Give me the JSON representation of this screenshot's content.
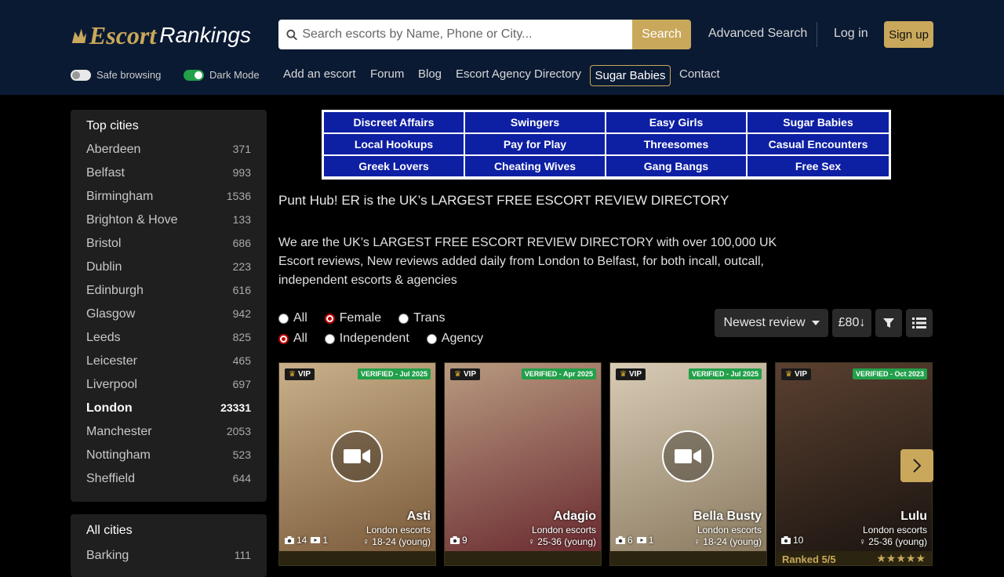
{
  "header": {
    "logo_part1": "Escort",
    "logo_part2": "Rankings",
    "search_placeholder": "Search escorts by Name, Phone or City...",
    "search_button": "Search",
    "advanced_search": "Advanced Search",
    "login": "Log in",
    "signup": "Sign up",
    "toggles": [
      {
        "label": "Safe browsing",
        "on": false
      },
      {
        "label": "Dark Mode",
        "on": true
      }
    ],
    "nav": [
      "Add an escort",
      "Forum",
      "Blog",
      "Escort Agency Directory",
      "Sugar Babies",
      "Contact"
    ]
  },
  "sidebar": {
    "title": "Top cities",
    "cities": [
      {
        "name": "Aberdeen",
        "count": "371"
      },
      {
        "name": "Belfast",
        "count": "993"
      },
      {
        "name": "Birmingham",
        "count": "1536"
      },
      {
        "name": "Brighton & Hove",
        "count": "133"
      },
      {
        "name": "Bristol",
        "count": "686"
      },
      {
        "name": "Dublin",
        "count": "223"
      },
      {
        "name": "Edinburgh",
        "count": "616"
      },
      {
        "name": "Glasgow",
        "count": "942"
      },
      {
        "name": "Leeds",
        "count": "825"
      },
      {
        "name": "Leicester",
        "count": "465"
      },
      {
        "name": "Liverpool",
        "count": "697"
      },
      {
        "name": "London",
        "count": "23331"
      },
      {
        "name": "Manchester",
        "count": "2053"
      },
      {
        "name": "Nottingham",
        "count": "523"
      },
      {
        "name": "Sheffield",
        "count": "644"
      }
    ],
    "all_title": "All cities",
    "all_cities": [
      {
        "name": "Barking",
        "count": "111"
      }
    ]
  },
  "banner": [
    "Discreet Affairs",
    "Swingers",
    "Easy Girls",
    "Sugar Babies",
    "Local Hookups",
    "Pay for Play",
    "Threesomes",
    "Casual Encounters",
    "Greek Lovers",
    "Cheating Wives",
    "Gang Bangs",
    "Free Sex"
  ],
  "main": {
    "heading": "Punt Hub! ER is the UK’s LARGEST FREE ESCORT REVIEW DIRECTORY",
    "intro": "We are the UK’s LARGEST FREE ESCORT REVIEW DIRECTORY with over 100,000 UK Escort reviews, New reviews added daily from London to Belfast, for both incall, outcall, independent escorts & agencies",
    "gender_filters": [
      "All",
      "Female",
      "Trans"
    ],
    "gender_selected": "Female",
    "type_filters": [
      "All",
      "Independent",
      "Agency"
    ],
    "type_selected": "All",
    "sort_label": "Newest review",
    "price_label": "£80↓"
  },
  "cards": [
    {
      "vip": "VIP",
      "verified": "VERIFIED - Jul 2025",
      "name": "Asti",
      "location": "London escorts",
      "age": "18-24 (young)",
      "photos": "14",
      "videos": "1",
      "has_video": true,
      "colors": [
        "#c9b08a",
        "#7a5a3a"
      ]
    },
    {
      "vip": "VIP",
      "verified": "VERIFIED - Apr 2025",
      "name": "Adagio",
      "location": "London escorts",
      "age": "25-36 (young)",
      "photos": "9",
      "videos": "",
      "has_video": false,
      "colors": [
        "#b89a80",
        "#6a2a30"
      ]
    },
    {
      "vip": "VIP",
      "verified": "VERIFIED - Jul 2025",
      "name": "Bella Busty",
      "location": "London escorts",
      "age": "18-24 (young)",
      "photos": "6",
      "videos": "1",
      "has_video": true,
      "colors": [
        "#d8cbb5",
        "#8a7a60"
      ]
    },
    {
      "vip": "VIP",
      "verified": "VERIFIED - Oct 2023",
      "name": "Lulu",
      "location": "London escorts",
      "age": "25-36 (young)",
      "photos": "10",
      "videos": "",
      "has_video": false,
      "ranked": "Ranked 5/5",
      "colors": [
        "#5a4030",
        "#1a1410"
      ]
    }
  ]
}
